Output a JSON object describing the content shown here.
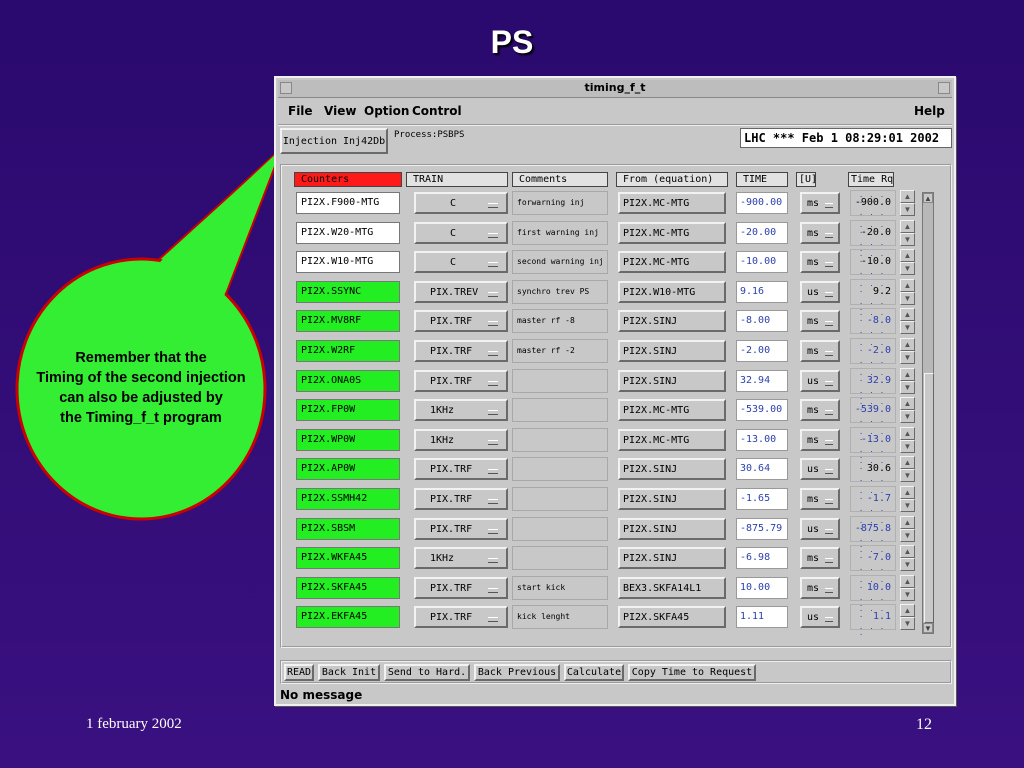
{
  "slide": {
    "title": "PS",
    "footer_date": "1 february 2002",
    "page_number": "12",
    "callout_text_lines": [
      "Remember that the",
      "Timing of the second injection",
      "can also be adjusted by",
      "the Timing_f_t program"
    ],
    "callout_color": "#33ee33",
    "callout_border": "#cc0000"
  },
  "window": {
    "title": "timing_f_t",
    "menus": [
      "File",
      "View",
      "Option",
      "Control"
    ],
    "help": "Help",
    "process_button": "Injection Inj42Db",
    "process_label": "Process:PSBPS",
    "status": "LHC *** Feb  1 08:29:01 2002",
    "status_message": "No message"
  },
  "headers": {
    "counters": "Counters",
    "train": "TRAIN",
    "comments": "Comments",
    "from": "From (equation)",
    "time": "TIME",
    "unit": "[U]",
    "time_rq": "Time Rq"
  },
  "rows": [
    {
      "counter": "PI2X.F900-MTG",
      "green": false,
      "train": "C",
      "comment": "forwarning inj",
      "from": "PI2X.MC-MTG",
      "time": "-900.00",
      "unit": "ms",
      "rq": "-900.0",
      "rq_blue": false
    },
    {
      "counter": "PI2X.W20-MTG",
      "green": false,
      "train": "C",
      "comment": "first warning inj",
      "from": "PI2X.MC-MTG",
      "time": "-20.00",
      "unit": "ms",
      "rq": "-20.0",
      "rq_blue": false
    },
    {
      "counter": "PI2X.W10-MTG",
      "green": false,
      "train": "C",
      "comment": "second warning inj",
      "from": "PI2X.MC-MTG",
      "time": "-10.00",
      "unit": "ms",
      "rq": "-10.0",
      "rq_blue": false
    },
    {
      "counter": "PI2X.SSYNC",
      "green": true,
      "train": "PIX.TREV",
      "comment": "synchro trev PS",
      "from": "PI2X.W10-MTG",
      "time": "9.16",
      "unit": "us",
      "rq": "9.2",
      "rq_blue": false
    },
    {
      "counter": "PI2X.MV8RF",
      "green": true,
      "train": "PIX.TRF",
      "comment": "master rf -8",
      "from": "PI2X.SINJ",
      "time": "-8.00",
      "unit": "ms",
      "rq": "-8.0",
      "rq_blue": true
    },
    {
      "counter": "PI2X.W2RF",
      "green": true,
      "train": "PIX.TRF",
      "comment": "master rf -2",
      "from": "PI2X.SINJ",
      "time": "-2.00",
      "unit": "ms",
      "rq": "-2.0",
      "rq_blue": true
    },
    {
      "counter": "PI2X.ONA0S",
      "green": true,
      "train": "PIX.TRF",
      "comment": "",
      "from": "PI2X.SINJ",
      "time": "32.94",
      "unit": "us",
      "rq": "32.9",
      "rq_blue": true
    },
    {
      "counter": "PI2X.FP0W",
      "green": true,
      "train": "1KHz",
      "comment": "",
      "from": "PI2X.MC-MTG",
      "time": "-539.00",
      "unit": "ms",
      "rq": "-539.0",
      "rq_blue": true
    },
    {
      "counter": "PI2X.WP0W",
      "green": true,
      "train": "1KHz",
      "comment": "",
      "from": "PI2X.MC-MTG",
      "time": "-13.00",
      "unit": "ms",
      "rq": "-13.0",
      "rq_blue": true
    },
    {
      "counter": "PI2X.AP0W",
      "green": true,
      "train": "PIX.TRF",
      "comment": "",
      "from": "PI2X.SINJ",
      "time": "30.64",
      "unit": "us",
      "rq": "30.6",
      "rq_blue": false
    },
    {
      "counter": "PI2X.SSMH42",
      "green": true,
      "train": "PIX.TRF",
      "comment": "",
      "from": "PI2X.SINJ",
      "time": "-1.65",
      "unit": "ms",
      "rq": "-1.7",
      "rq_blue": true
    },
    {
      "counter": "PI2X.SBSM",
      "green": true,
      "train": "PIX.TRF",
      "comment": "",
      "from": "PI2X.SINJ",
      "time": "-875.79",
      "unit": "us",
      "rq": "-875.8",
      "rq_blue": true
    },
    {
      "counter": "PI2X.WKFA45",
      "green": true,
      "train": "1KHz",
      "comment": "",
      "from": "PI2X.SINJ",
      "time": "-6.98",
      "unit": "ms",
      "rq": "-7.0",
      "rq_blue": true
    },
    {
      "counter": "PI2X.SKFA45",
      "green": true,
      "train": "PIX.TRF",
      "comment": "start kick",
      "from": "BEX3.SKFA14L1",
      "time": "10.00",
      "unit": "ms",
      "rq": "10.0",
      "rq_blue": true
    },
    {
      "counter": "PI2X.EKFA45",
      "green": true,
      "train": "PIX.TRF",
      "comment": "kick lenght",
      "from": "PI2X.SKFA45",
      "time": "1.11",
      "unit": "us",
      "rq": "1.1",
      "rq_blue": true
    }
  ],
  "bottom_buttons": [
    "READ",
    "Back Init",
    "Send to Hard.",
    "Back Previous",
    "Calculate",
    "Copy Time to Request"
  ],
  "colors": {
    "green_cell": "#22ee22",
    "white_cell": "#ffffff",
    "header_red": "#ff1a1a",
    "value_blue": "#2b3fae"
  },
  "icons": [
    "dropdown-arrow-icon",
    "spin-up-icon",
    "spin-down-icon",
    "scroll-up-icon",
    "scroll-down-icon"
  ]
}
